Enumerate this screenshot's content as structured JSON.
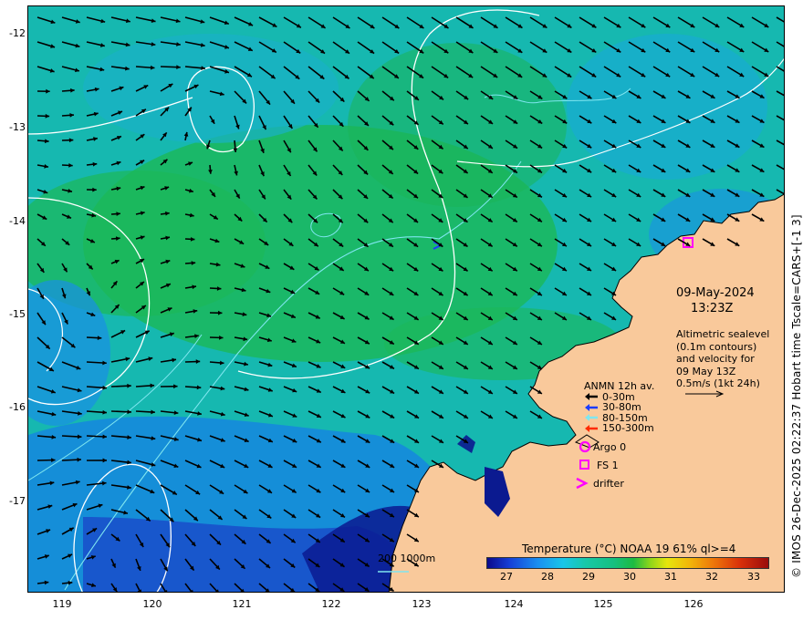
{
  "map": {
    "lat_ticks": [
      "-12",
      "-13",
      "-14",
      "-15",
      "-16",
      "-17"
    ],
    "lon_ticks": [
      "119",
      "120",
      "121",
      "122",
      "123",
      "124",
      "125",
      "126"
    ],
    "land_color": "#f9c99b",
    "shelf_contour_color": "#7fe6f0",
    "sealevel_contour_color": "#ffffff"
  },
  "annotation": {
    "date": "09-May-2024",
    "time": "13:23Z",
    "desc_lines": [
      "Altimetric sealevel",
      "(0.1m contours)",
      "and velocity for",
      "09 May 13Z",
      "0.5m/s (1kt 24h)"
    ]
  },
  "legend": {
    "title": "ANMN 12h av.",
    "items": [
      {
        "label": "0-30m",
        "color": "#000000"
      },
      {
        "label": "30-80m",
        "color": "#1a3cff"
      },
      {
        "label": "80-150m",
        "color": "#7fe6f0"
      },
      {
        "label": "150-300m",
        "color": "#ff2a00"
      }
    ]
  },
  "markers": {
    "argo": "Argo 0",
    "fs": "FS 1",
    "drifter": "drifter",
    "marker_color": "#ff00ff"
  },
  "colorbar": {
    "title": "Temperature (°C) NOAA 19 61% ql>=4",
    "ticks": [
      "27",
      "28",
      "29",
      "30",
      "31",
      "32",
      "33"
    ]
  },
  "contour_key": "200  1000m",
  "credit": "© IMOS 26-Dec-2025 02:22:37 Hobart time Tscale=CARS+[-1 3]"
}
